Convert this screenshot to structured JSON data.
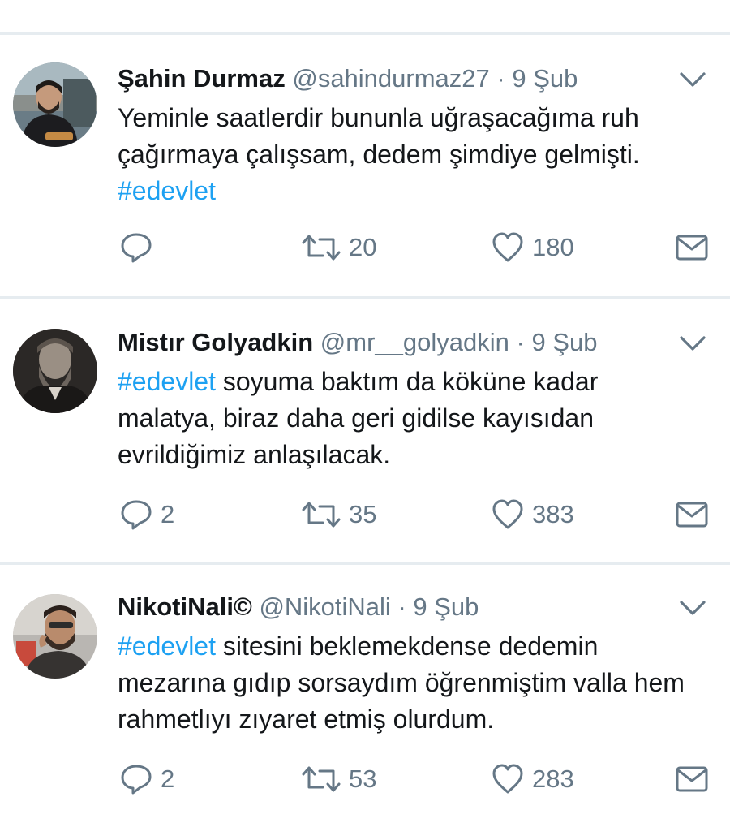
{
  "tweets": [
    {
      "name": "Şahin Durmaz",
      "handle": "@sahindurmaz27",
      "separator": "·",
      "date": "9 Şub",
      "text_before": "Yeminle saatlerdir bununla uğraşacağıma ruh çağırmaya çalışsam, dedem şimdiye gelmişti. ",
      "hashtag": "#edevlet",
      "text_after": "",
      "replies": "",
      "retweets": "20",
      "likes": "180"
    },
    {
      "name": "Mistır Golyadkin",
      "handle": "@mr__golyadkin",
      "separator": "·",
      "date": "9 Şub",
      "text_before": "",
      "hashtag": "#edevlet",
      "text_after": " soyuma baktım da köküne kadar malatya, biraz daha geri gidilse kayısıdan evrildiğimiz anlaşılacak.",
      "replies": "2",
      "retweets": "35",
      "likes": "383"
    },
    {
      "name": "NikotiNali©",
      "handle": "@NikotiNali",
      "separator": "·",
      "date": "9 Şub",
      "text_before": "",
      "hashtag": "#edevlet",
      "text_after": " sitesini beklemekdense dedemin mezarına gıdıp sorsaydım öğrenmiştim valla hem rahmetlıyı zıyaret etmiş olurdum.",
      "replies": "2",
      "retweets": "53",
      "likes": "283"
    }
  ],
  "icons": {
    "reply": "reply-icon",
    "retweet": "retweet-icon",
    "like": "heart-icon",
    "dm": "envelope-icon",
    "menu": "chevron-down-icon"
  },
  "colors": {
    "text": "#14171a",
    "muted": "#657786",
    "hashtag": "#1da1f2",
    "divider": "#e6ecf0"
  }
}
